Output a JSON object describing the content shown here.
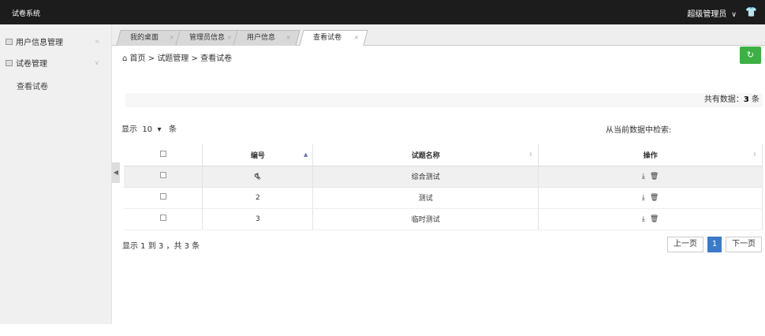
{
  "app": {
    "title": "试卷系统",
    "user": "超级管理员"
  },
  "sidebar": {
    "items": [
      {
        "label": "用户信息管理"
      },
      {
        "label": "试卷管理"
      }
    ],
    "sub_items": [
      {
        "label": "查看试卷"
      }
    ]
  },
  "tabs": [
    {
      "label": "我的桌面"
    },
    {
      "label": "管理员信息"
    },
    {
      "label": "用户信息"
    },
    {
      "label": "查看试卷"
    }
  ],
  "breadcrumb": {
    "home": "首页",
    "section": "试题管理",
    "page": "查看试卷",
    "separator": ">"
  },
  "summary": {
    "label": "共有数据：",
    "count": "3",
    "unit": "条"
  },
  "table_controls": {
    "show_prefix": "显示",
    "page_size": "10",
    "show_suffix": "条",
    "search_label": "从当前数据中检索:"
  },
  "table": {
    "headers": [
      "编号",
      "试题名称",
      "操作"
    ],
    "rows": [
      {
        "id": "1",
        "name": "综合测试"
      },
      {
        "id": "2",
        "name": "测试"
      },
      {
        "id": "3",
        "name": "临时测试"
      }
    ]
  },
  "pagination": {
    "info": "显示 1 到 3 ，共 3 条",
    "prev": "上一页",
    "current": "1",
    "next": "下一页"
  },
  "colors": {
    "topbar": "#1c1c1c",
    "refresh_button": "#3cb043",
    "page_active": "#3a7ac8"
  }
}
